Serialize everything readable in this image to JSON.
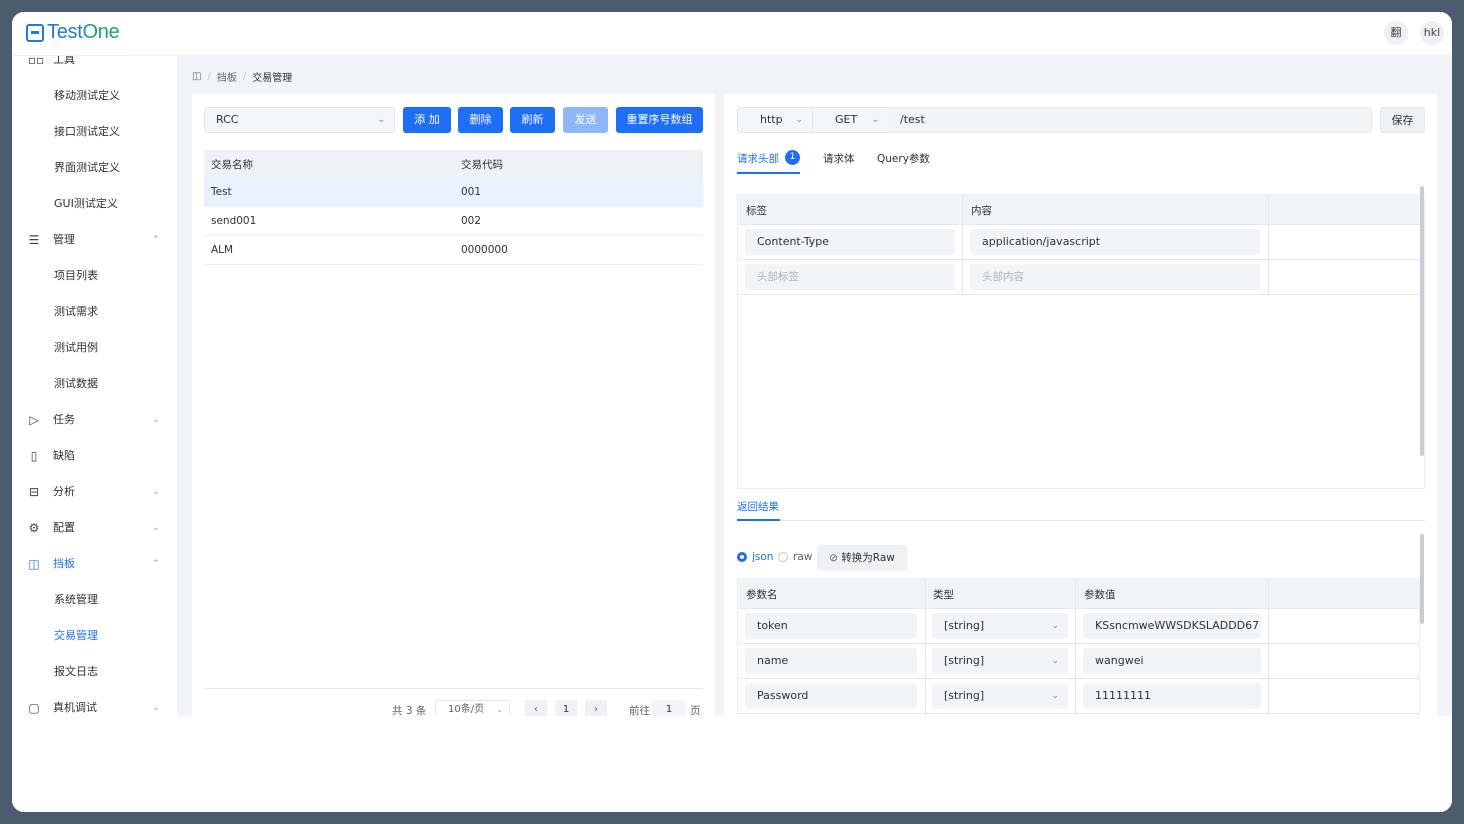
{
  "app": {
    "logo_prefix": "Test",
    "logo_suffix": "One"
  },
  "header": {
    "translate_icon": "翻",
    "user": "hkl"
  },
  "sidebar": {
    "items": [
      {
        "label": "工具",
        "icon": "grid-icon",
        "glyph": "▫▫",
        "type": "group",
        "chevron": ""
      },
      {
        "label": "移动测试定义",
        "type": "sub"
      },
      {
        "label": "接口测试定义",
        "type": "sub"
      },
      {
        "label": "界面测试定义",
        "type": "sub"
      },
      {
        "label": "GUI测试定义",
        "type": "sub"
      },
      {
        "label": "管理",
        "icon": "list-icon",
        "glyph": "☰",
        "type": "group",
        "chevron": "⌃"
      },
      {
        "label": "项目列表",
        "type": "sub"
      },
      {
        "label": "测试需求",
        "type": "sub"
      },
      {
        "label": "测试用例",
        "type": "sub"
      },
      {
        "label": "测试数据",
        "type": "sub"
      },
      {
        "label": "任务",
        "icon": "send-icon",
        "glyph": "▷",
        "type": "group",
        "chevron": "⌄"
      },
      {
        "label": "缺陷",
        "icon": "document-icon",
        "glyph": "▯",
        "type": "group",
        "chevron": ""
      },
      {
        "label": "分析",
        "icon": "chart-icon",
        "glyph": "⊟",
        "type": "group",
        "chevron": "⌄"
      },
      {
        "label": "配置",
        "icon": "gear-icon",
        "glyph": "⚙",
        "type": "group",
        "chevron": "⌄"
      },
      {
        "label": "挡板",
        "icon": "panel-icon",
        "glyph": "◫",
        "type": "group",
        "chevron": "⌃",
        "active": true
      },
      {
        "label": "系统管理",
        "type": "sub"
      },
      {
        "label": "交易管理",
        "type": "sub",
        "active": true
      },
      {
        "label": "报文日志",
        "type": "sub"
      },
      {
        "label": "真机调试",
        "icon": "device-icon",
        "glyph": "▢",
        "type": "group",
        "chevron": "⌄"
      }
    ]
  },
  "breadcrumb": {
    "icon": "◫",
    "sep": "/",
    "parent": "挡板",
    "current": "交易管理"
  },
  "left": {
    "system_select": "RCC",
    "buttons": {
      "add": "添 加",
      "delete": "删除",
      "refresh": "刷新",
      "send": "发送",
      "reset": "重置序号数组"
    },
    "columns": [
      "交易名称",
      "交易代码"
    ],
    "rows": [
      {
        "name": "Test",
        "code": "001"
      },
      {
        "name": "send001",
        "code": "002"
      },
      {
        "name": "ALM",
        "code": "0000000"
      }
    ],
    "pager": {
      "total": "共 3 条",
      "page_size": "10条/页",
      "prev": "‹",
      "page": "1",
      "next": "›",
      "goto_label": "前往",
      "goto_value": "1",
      "goto_suffix": "页"
    }
  },
  "right": {
    "protocol": "http",
    "method": "GET",
    "path": "/test",
    "save": "保存",
    "tabs": {
      "headers": "请求头部",
      "headers_count": "1",
      "body": "请求体",
      "query": "Query参数"
    },
    "header_columns": [
      "标签",
      "内容"
    ],
    "header_rows": [
      {
        "key": "Content-Type",
        "value": "application/javascript"
      }
    ],
    "header_placeholders": {
      "key": "头部标签",
      "value": "头部内容"
    },
    "result_tab": "返回结果",
    "format": {
      "json": "json",
      "raw": "raw",
      "convert": "转换为Raw"
    },
    "param_columns": [
      "参数名",
      "类型",
      "参数值"
    ],
    "params": [
      {
        "name": "token",
        "type": "[string]",
        "value": "KSsncmweWWSDKSLADDD67"
      },
      {
        "name": "name",
        "type": "[string]",
        "value": "wangwei"
      },
      {
        "name": "Password",
        "type": "[string]",
        "value": "11111111"
      }
    ]
  }
}
